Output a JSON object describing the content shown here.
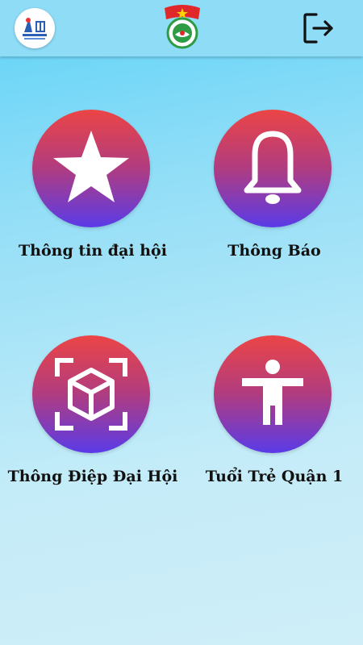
{
  "header": {
    "left_logo_icon": "dai-hoi-xiii-logo-icon",
    "center_logo_icon": "youth-union-emblem-icon",
    "logout_icon": "logout-icon"
  },
  "menu": [
    {
      "label": "Thông tin đại hội",
      "icon": "star-icon"
    },
    {
      "label": "Thông Báo",
      "icon": "bell-icon"
    },
    {
      "label": "Thông Điệp Đại Hội",
      "icon": "ar-cube-icon"
    },
    {
      "label": "Tuổi Trẻ Quận 1",
      "icon": "person-icon"
    }
  ],
  "colors": {
    "header": "#8fdcf7",
    "circle_top": "#ec4545",
    "circle_bottom": "#5a3be8",
    "label": "#111111"
  }
}
